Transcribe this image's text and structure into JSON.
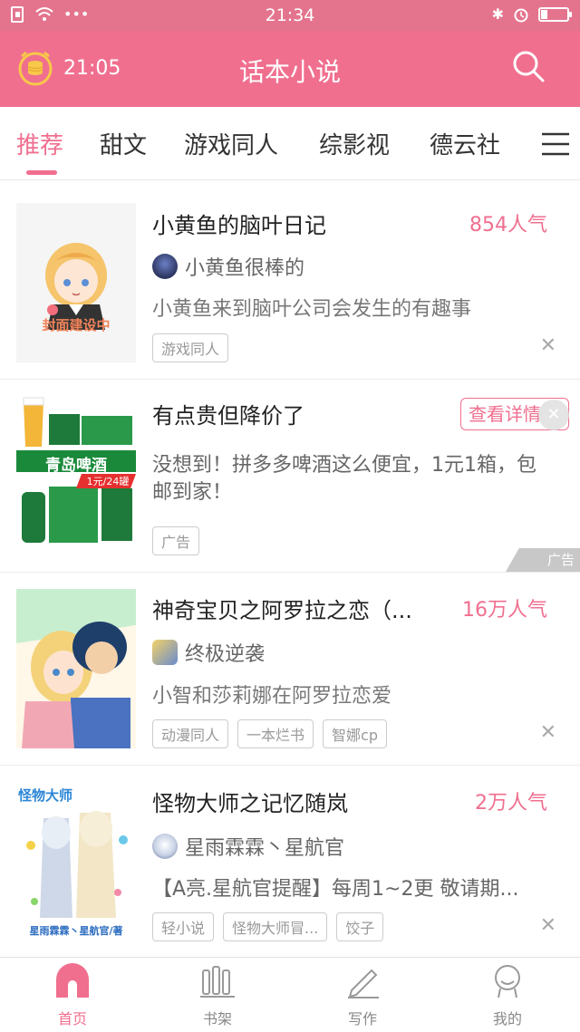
{
  "status_bar": {
    "time": "21:34"
  },
  "app_bar": {
    "clock_time": "21:05",
    "title": "话本小说"
  },
  "tabs": [
    {
      "label": "推荐"
    },
    {
      "label": "甜文"
    },
    {
      "label": "游戏同人"
    },
    {
      "label": "综影视"
    },
    {
      "label": "德云社"
    }
  ],
  "feed": [
    {
      "title": "小黄鱼的脑叶日记",
      "popularity": "854人气",
      "author": "小黄鱼很棒的",
      "description": "小黄鱼来到脑叶公司会发生的有趣事",
      "cover_text": "封面建设中",
      "tags": [
        "游戏同人"
      ]
    },
    {
      "title": "有点贵但降价了",
      "action_label": "查看详情",
      "description": "没想到！拼多多啤酒这么便宜，1元1箱，包邮到家！",
      "tag": "广告",
      "corner_label": "广告",
      "cover_banner": "青岛啤酒",
      "cover_price": "1元/24罐"
    },
    {
      "title": "神奇宝贝之阿罗拉之恋（...",
      "popularity": "16万人气",
      "author": "终极逆袭",
      "description": "小智和莎莉娜在阿罗拉恋爱",
      "tags": [
        "动漫同人",
        "一本烂书",
        "智娜cp"
      ]
    },
    {
      "title": "怪物大师之记忆随岚",
      "popularity": "2万人气",
      "author": "星雨霖霖丶星航官",
      "description": "【A亮.星航官提醒】每周1~2更 敬请期...",
      "cover_title": "怪物大师",
      "cover_credit": "星雨霖霖丶星航官/著",
      "tags": [
        "轻小说",
        "怪物大师冒...",
        "饺子"
      ]
    }
  ],
  "bottom_nav": [
    {
      "label": "首页"
    },
    {
      "label": "书架"
    },
    {
      "label": "写作"
    },
    {
      "label": "我的"
    }
  ],
  "colors": {
    "brand": "#f06f8f",
    "status_bar": "#e4748e"
  }
}
